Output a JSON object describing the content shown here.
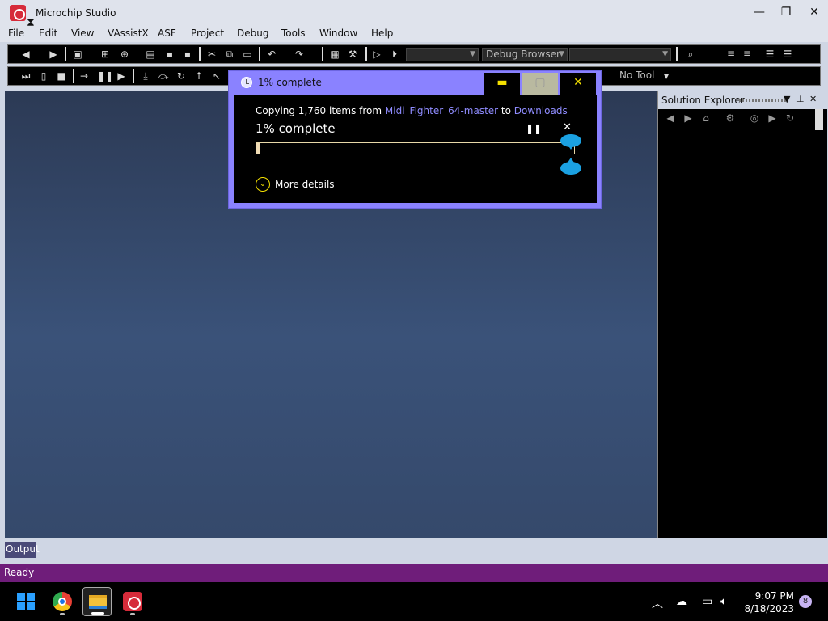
{
  "window": {
    "title": "Microchip Studio",
    "minimize": "—",
    "restore": "❐",
    "close": "✕"
  },
  "menu": [
    "File",
    "Edit",
    "View",
    "VAssistX",
    "ASF",
    "Project",
    "Debug",
    "Tools",
    "Window",
    "Help"
  ],
  "toolbar": {
    "debug_browser": "Debug Browser",
    "no_tool": "No Tool"
  },
  "solution_explorer": {
    "title": "Solution Explorer"
  },
  "output_tab": "Output",
  "status": "Ready",
  "taskbar": {
    "time": "9:07 PM",
    "date": "8/18/2023",
    "notifications": "8"
  },
  "dialog": {
    "title": "1% complete",
    "copy_prefix": "Copying 1,760 items from",
    "source": "Midi_Fighter_64-master",
    "to_word": "to",
    "destination": "Downloads",
    "percent_text": "1% complete",
    "progress": 0.01,
    "more_details": "More details",
    "minimize": "▬",
    "maximize": "▢",
    "close": "✕",
    "pause": "❚❚",
    "cancel": "✕",
    "chevron": "⌄"
  },
  "colors": {
    "accent": "#8a82ff",
    "status_bar": "#6f1d7a",
    "link": "#8f8cff",
    "highlight_text": "#f5e100"
  }
}
